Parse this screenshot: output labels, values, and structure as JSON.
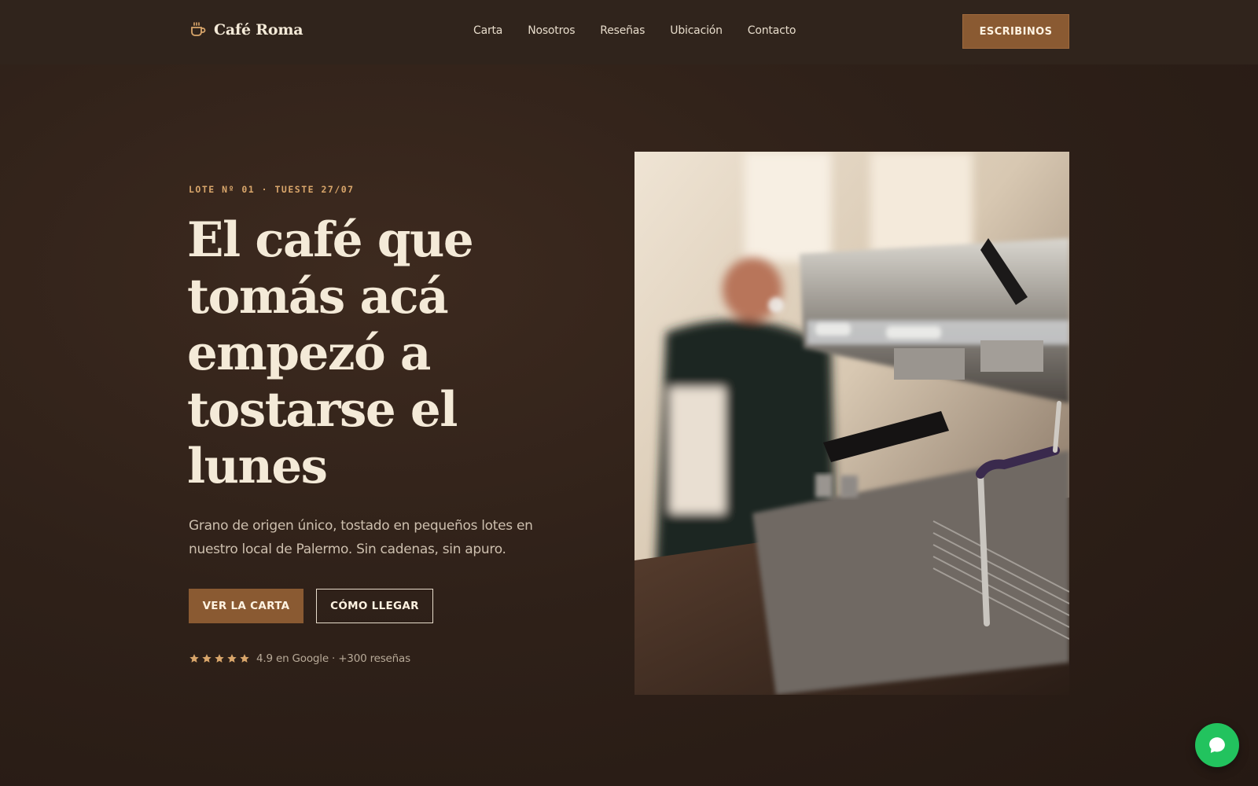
{
  "header": {
    "logo_icon": "coffee-cup-icon",
    "brand": "Café Roma",
    "nav": [
      {
        "label": "Carta"
      },
      {
        "label": "Nosotros"
      },
      {
        "label": "Reseñas"
      },
      {
        "label": "Ubicación"
      },
      {
        "label": "Contacto"
      }
    ],
    "cta_label": "ESCRIBINOS"
  },
  "hero": {
    "kicker": "LOTE Nº 01 · TUESTE 27/07",
    "headline": "El café que tomás acá empezó a tostarse el lunes",
    "lead": "Grano de origen único, tostado en pequeños lotes en nuestro local de Palermo. Sin cadenas, sin apuro.",
    "primary_button": "VER LA CARTA",
    "secondary_button": "CÓMO LLEGAR",
    "rating": {
      "stars": 5,
      "text": "4.9 en Google · +300 reseñas"
    },
    "photo_subject": "espresso-machine-photo"
  },
  "chat": {
    "icon": "chat-bubble-icon"
  },
  "colors": {
    "background": "#2f2119",
    "header": "#30241c",
    "accent": "#8a5a32",
    "kicker": "#d9a66b",
    "text_light": "#f4ead8",
    "star": "#d9a66b",
    "chat_green": "#22c35e"
  }
}
